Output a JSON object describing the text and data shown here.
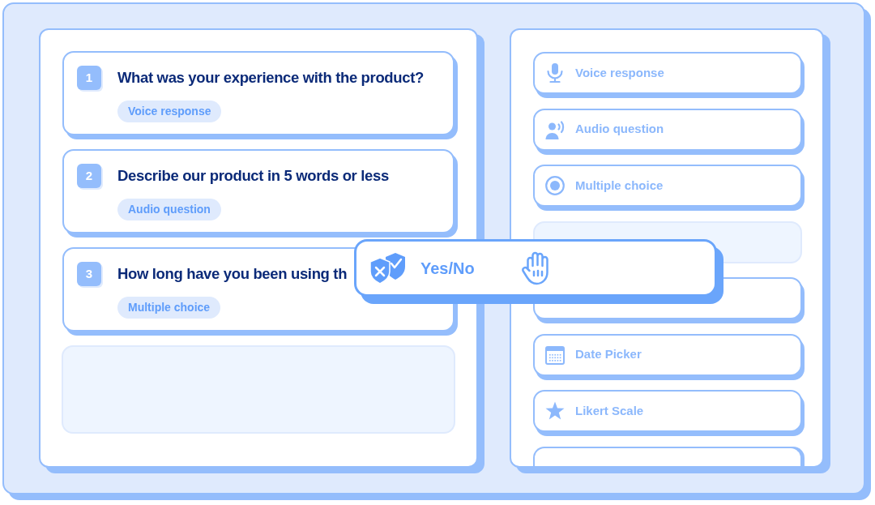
{
  "question_list": {
    "questions": [
      {
        "number": "1",
        "text": "What was your experience with the product?",
        "type": "Voice response"
      },
      {
        "number": "2",
        "text": "Describe our product in 5 words or less",
        "type": "Audio question"
      },
      {
        "number": "3",
        "text": "How long have you been using th",
        "type": "Multiple choice"
      }
    ],
    "drop_zone": true
  },
  "field_types": {
    "items": [
      {
        "kind": "voice",
        "label": "Voice response"
      },
      {
        "kind": "audio",
        "label": "Audio question"
      },
      {
        "kind": "choice",
        "label": "Multiple choice"
      },
      {
        "kind": "slot"
      },
      {
        "kind": "covered"
      },
      {
        "kind": "date",
        "label": "Date Picker"
      },
      {
        "kind": "scale",
        "label": "Likert Scale"
      },
      {
        "kind": "cutoff"
      }
    ]
  },
  "dragged_item": {
    "kind": "yesno",
    "label": "Yes/No"
  }
}
